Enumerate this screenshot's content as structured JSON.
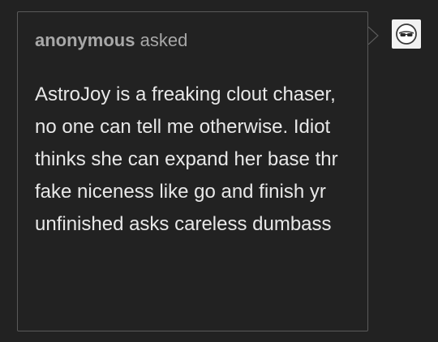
{
  "ask": {
    "asker_name": "anonymous",
    "asked_label": "asked",
    "question": "AstroJoy is a freaking clout chaser, no one can tell me otherwise. Idiot thinks she can expand her base thr fake niceness like go and finish yr unfinished asks careless dumbass"
  },
  "avatar": {
    "icon": "anonymous-sunglasses-icon"
  },
  "colors": {
    "background": "#222222",
    "border": "#5a5a5a",
    "asker_text": "#a8a8a8",
    "question_text": "#e8e8e8",
    "avatar_bg": "#f2f2f2"
  }
}
